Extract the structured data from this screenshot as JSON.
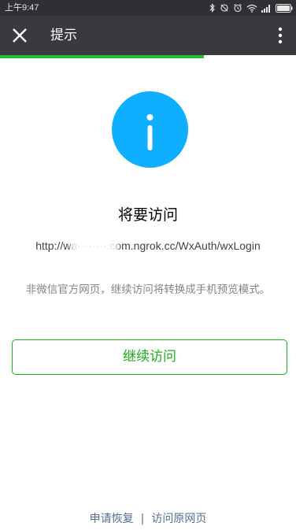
{
  "status_bar": {
    "time": "上午9:47"
  },
  "header": {
    "title": "提示"
  },
  "progress": {
    "fraction": 0.69,
    "color": "#2bbb3b"
  },
  "main": {
    "heading": "将要访问",
    "url": "http://wa········.com.ngrok.cc/WxAuth/wxLogin",
    "notice": "非微信官方网页，继续访问将转换成手机预览模式。",
    "continue_label": "继续访问"
  },
  "footer": {
    "restore_label": "申请恢复",
    "separator": "|",
    "original_label": "访问原网页"
  },
  "colors": {
    "accent_green": "#1aad19",
    "info_blue": "#10aeff",
    "link_blue": "#576b95",
    "header_bg": "#393a3f"
  },
  "icons": [
    "close-icon",
    "more-vertical-icon",
    "info-icon",
    "bluetooth-icon",
    "alarm-icon",
    "wifi-icon",
    "signal-icon",
    "battery-icon"
  ]
}
